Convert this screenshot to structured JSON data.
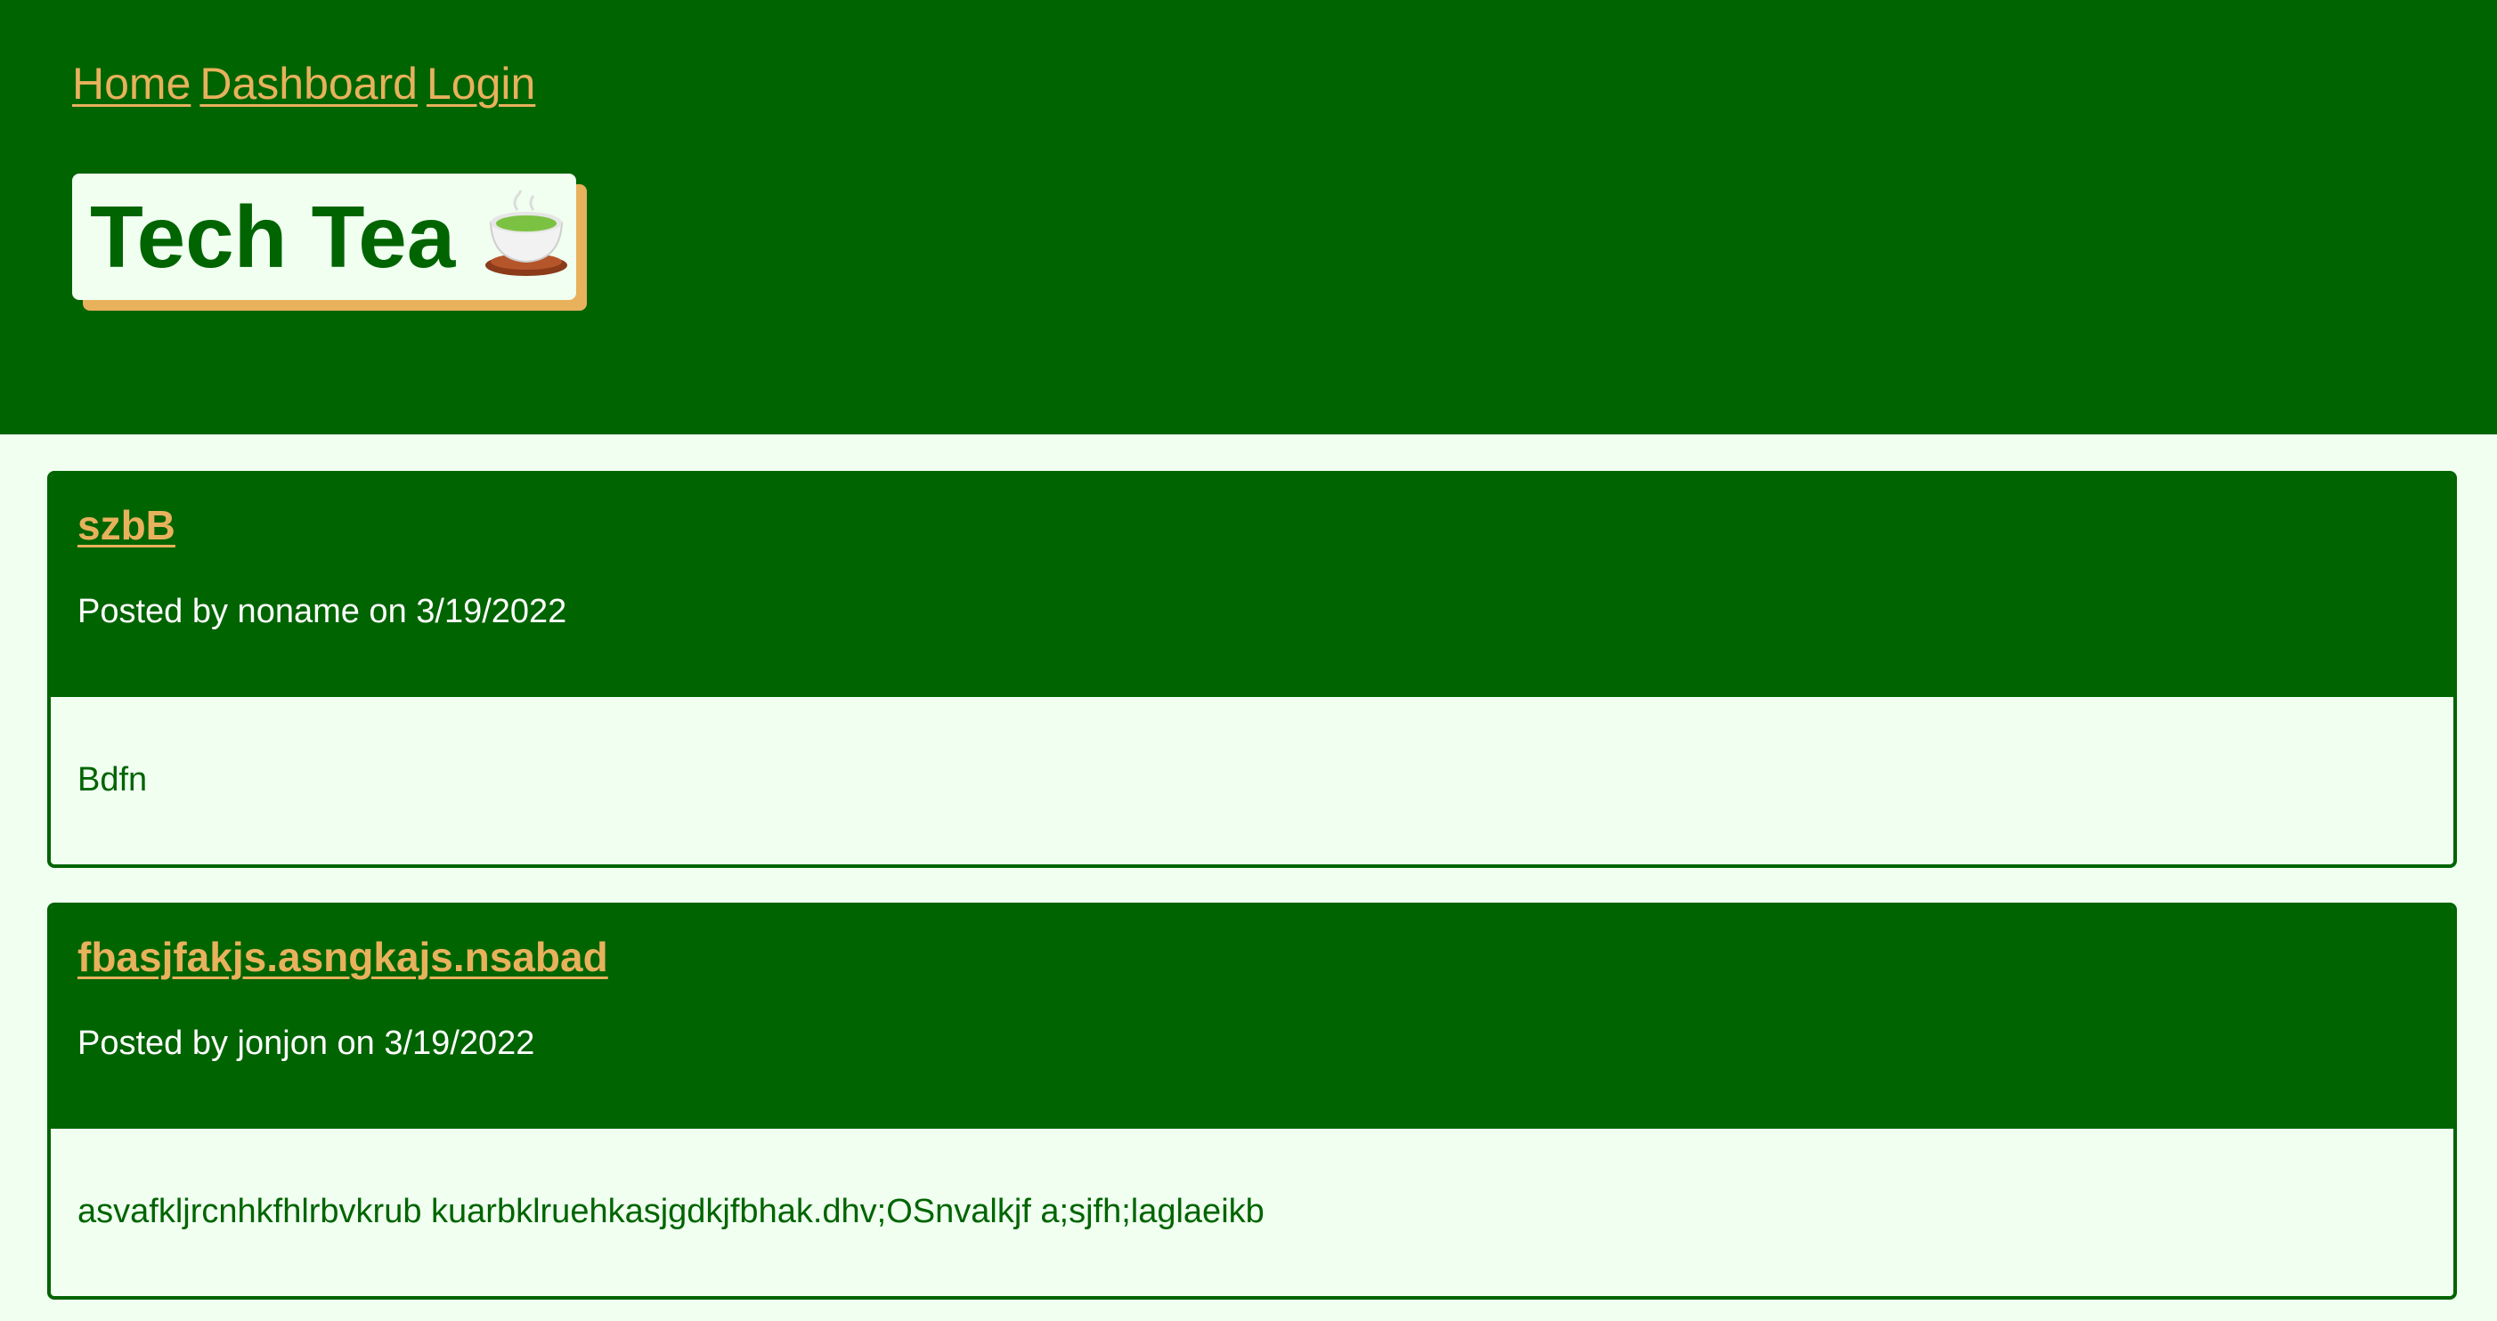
{
  "nav": {
    "items": [
      "Home",
      "Dashboard",
      "Login"
    ]
  },
  "site": {
    "title": "Tech Tea",
    "logo_icon": "tea-cup-icon"
  },
  "posts": [
    {
      "title": "szbB",
      "meta": "Posted by noname on 3/19/2022",
      "content": "Bdfn"
    },
    {
      "title": "fbasjfakjs.asngkajs.nsabad",
      "meta": "Posted by jonjon on 3/19/2022",
      "content": "asvafkljrcnhkfhlrbvkrub kuarbklruehkasjgdkjfbhak.dhv;OSnvalkjf a;sjfh;laglaeikb"
    }
  ],
  "colors": {
    "brand_green": "#006400",
    "accent_gold": "#e8b15c",
    "background": "#f0fff0"
  }
}
